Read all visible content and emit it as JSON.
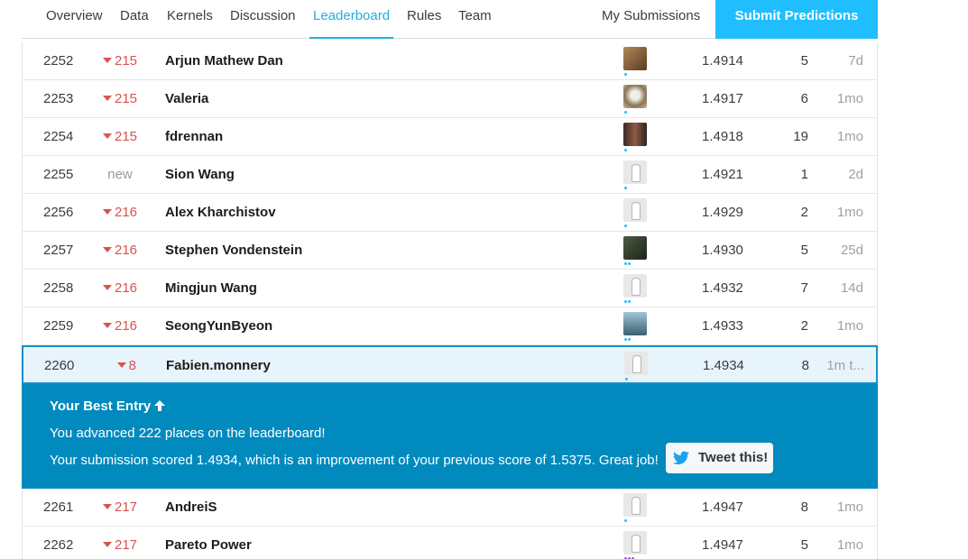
{
  "nav": {
    "tabs": [
      "Overview",
      "Data",
      "Kernels",
      "Discussion",
      "Leaderboard",
      "Rules",
      "Team"
    ],
    "active_tab": "Leaderboard",
    "my_submissions": "My Submissions",
    "submit_predictions": "Submit Predictions"
  },
  "rows_top": [
    {
      "rank": "2252",
      "change": "215",
      "name": "Arjun Mathew Dan",
      "score": "1.4914",
      "entries": "5",
      "last": "7d"
    },
    {
      "rank": "2253",
      "change": "215",
      "name": "Valeria",
      "score": "1.4917",
      "entries": "6",
      "last": "1mo"
    },
    {
      "rank": "2254",
      "change": "215",
      "name": "fdrennan",
      "score": "1.4918",
      "entries": "19",
      "last": "1mo"
    },
    {
      "rank": "2255",
      "change": "new",
      "name": "Sion Wang",
      "score": "1.4921",
      "entries": "1",
      "last": "2d"
    },
    {
      "rank": "2256",
      "change": "216",
      "name": "Alex Kharchistov",
      "score": "1.4929",
      "entries": "2",
      "last": "1mo"
    },
    {
      "rank": "2257",
      "change": "216",
      "name": "Stephen Vondenstein",
      "score": "1.4930",
      "entries": "5",
      "last": "25d"
    },
    {
      "rank": "2258",
      "change": "216",
      "name": "Mingjun Wang",
      "score": "1.4932",
      "entries": "7",
      "last": "14d"
    },
    {
      "rank": "2259",
      "change": "216",
      "name": "SeongYunByeon",
      "score": "1.4933",
      "entries": "2",
      "last": "1mo"
    }
  ],
  "my_row": {
    "rank": "2260",
    "change": "8",
    "name": "Fabien.monnery",
    "score": "1.4934",
    "entries": "8",
    "last": "1m t..."
  },
  "banner": {
    "title": "Your Best Entry",
    "line1": "You advanced 222 places on the leaderboard!",
    "line2": "Your submission scored 1.4934, which is an improvement of your previous score of 1.5375. Great job!",
    "tweet_label": "Tweet this!"
  },
  "rows_bottom": [
    {
      "rank": "2261",
      "change": "217",
      "name": "AndreiS",
      "score": "1.4947",
      "entries": "8",
      "last": "1mo"
    },
    {
      "rank": "2262",
      "change": "217",
      "name": "Pareto Power",
      "score": "1.4947",
      "entries": "5",
      "last": "1mo"
    }
  ],
  "colors": {
    "accent": "#20beff",
    "banner": "#008abe",
    "drop": "#d9534f"
  }
}
